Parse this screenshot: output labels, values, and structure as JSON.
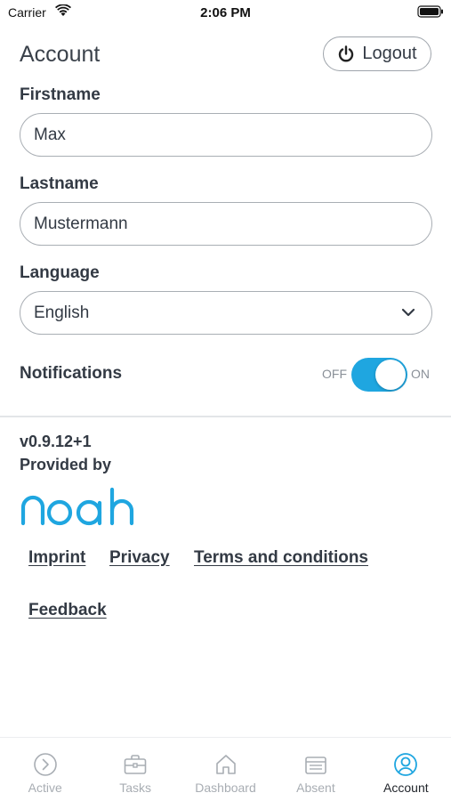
{
  "status_bar": {
    "carrier": "Carrier",
    "time": "2:06 PM"
  },
  "header": {
    "title": "Account",
    "logout_label": "Logout"
  },
  "form": {
    "firstname": {
      "label": "Firstname",
      "value": "Max"
    },
    "lastname": {
      "label": "Lastname",
      "value": "Mustermann"
    },
    "language": {
      "label": "Language",
      "value": "English"
    },
    "notifications": {
      "label": "Notifications",
      "off_label": "OFF",
      "on_label": "ON",
      "enabled": true
    }
  },
  "about": {
    "version": "v0.9.12+1",
    "provided_by": "Provided by",
    "logo_text": "noah"
  },
  "links": {
    "imprint": "Imprint",
    "privacy": "Privacy",
    "terms": "Terms and conditions",
    "feedback": "Feedback"
  },
  "tab_bar": {
    "items": [
      {
        "label": "Active",
        "icon": "chevron-circle-icon"
      },
      {
        "label": "Tasks",
        "icon": "briefcase-icon"
      },
      {
        "label": "Dashboard",
        "icon": "home-icon"
      },
      {
        "label": "Absent",
        "icon": "calendar-icon"
      },
      {
        "label": "Account",
        "icon": "user-icon"
      }
    ],
    "active_index": 4
  },
  "colors": {
    "accent": "#1fa6e0",
    "text": "#333a44",
    "inactive_tab": "#a8adb3"
  }
}
